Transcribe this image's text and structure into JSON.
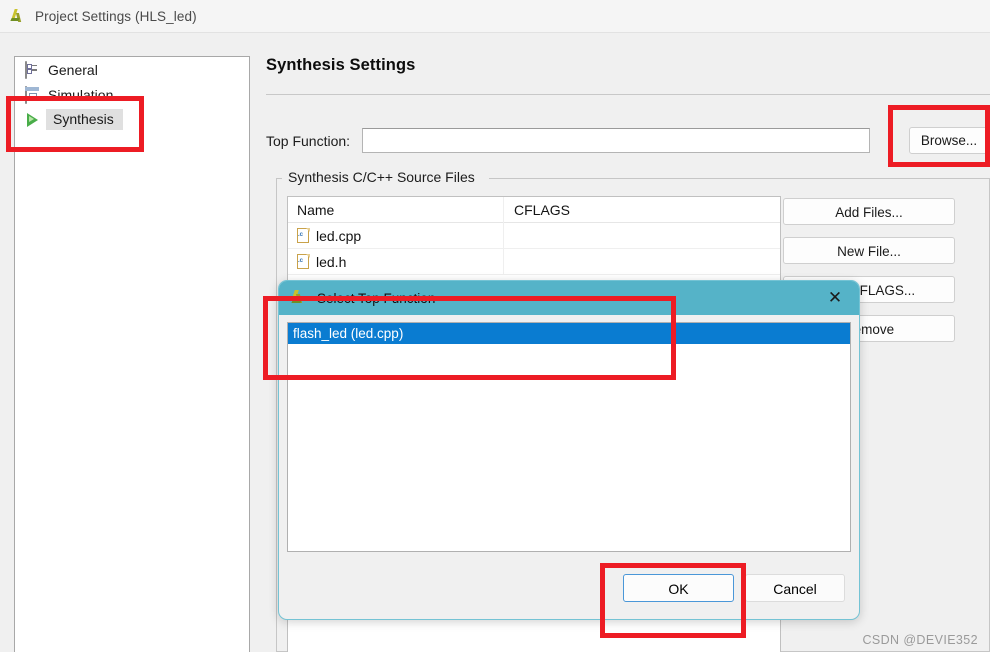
{
  "window": {
    "title": "Project Settings (HLS_led)",
    "icon": "vitis-hls-logo-icon"
  },
  "sidebar": {
    "items": [
      {
        "label": "General",
        "icon": "general-form-icon",
        "selected": false
      },
      {
        "label": "Simulation",
        "icon": "simulation-window-icon",
        "selected": false
      },
      {
        "label": "Synthesis",
        "icon": "synthesis-play-icon",
        "selected": true
      }
    ]
  },
  "pane": {
    "title": "Synthesis Settings",
    "top_function": {
      "label": "Top Function:",
      "value": "",
      "placeholder": ""
    },
    "browse_button": "Browse...",
    "group": {
      "legend": "Synthesis C/C++ Source Files",
      "table": {
        "columns": [
          "Name",
          "CFLAGS"
        ],
        "rows": [
          {
            "name": "led.cpp",
            "cflags": "",
            "icon": "c-file-icon"
          },
          {
            "name": "led.h",
            "cflags": "",
            "icon": "c-file-icon"
          }
        ]
      },
      "buttons": [
        "Add Files...",
        "New File...",
        "Edit CFLAGS...",
        "Remove"
      ]
    }
  },
  "dialog": {
    "title": "Select Top Function",
    "icon": "vitis-hls-logo-icon",
    "close_icon": "close-icon",
    "list": [
      {
        "label": "flash_led (led.cpp)",
        "selected": true
      }
    ],
    "ok_button": "OK",
    "cancel_button": "Cancel"
  },
  "annotations": {
    "color": "#ed1c24",
    "boxes": [
      "sidebar-synthesis-highlight",
      "browse-button-highlight",
      "top-function-list-item-highlight",
      "ok-button-highlight"
    ]
  },
  "watermark": "CSDN @DEVIE352"
}
